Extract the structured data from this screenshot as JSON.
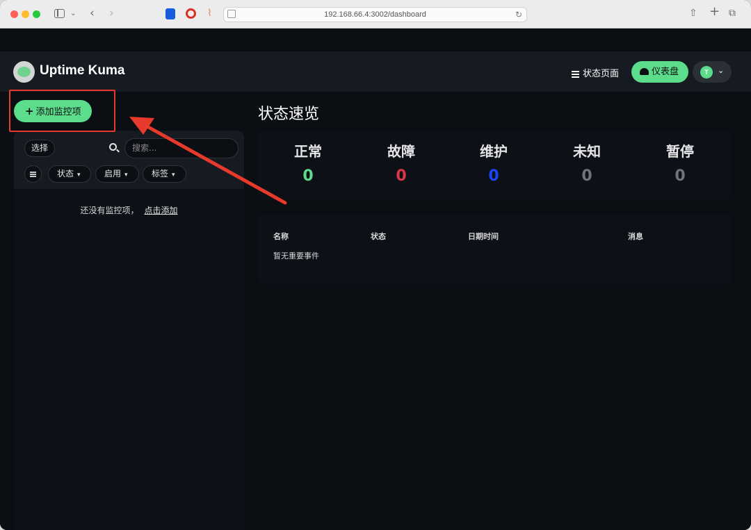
{
  "browser": {
    "url": "192.168.66.4:3002/dashboard"
  },
  "header": {
    "brand": "Uptime Kuma",
    "status_page_label": "状态页面",
    "dashboard_label": "仪表盘",
    "avatar_initial": "T"
  },
  "sidebar": {
    "add_monitor_label": "添加监控项",
    "select_label": "选择",
    "search_placeholder": "搜索...",
    "filters": [
      "状态",
      "启用",
      "标签"
    ],
    "empty_text": "还没有监控项，",
    "empty_link": "点击添加"
  },
  "main": {
    "title": "状态速览",
    "stats": [
      {
        "label": "正常",
        "value": "0",
        "color": "#5cdd8b"
      },
      {
        "label": "故障",
        "value": "0",
        "color": "#dc3545"
      },
      {
        "label": "维护",
        "value": "0",
        "color": "#1747f5"
      },
      {
        "label": "未知",
        "value": "0",
        "color": "#6c757d"
      },
      {
        "label": "暂停",
        "value": "0",
        "color": "#6c757d"
      }
    ],
    "events_table": {
      "headers": [
        "名称",
        "状态",
        "日期时间",
        "消息"
      ],
      "empty": "暂无重要事件"
    }
  },
  "colors": {
    "accent": "#5cdd8b",
    "annotation": "#e8392d"
  }
}
